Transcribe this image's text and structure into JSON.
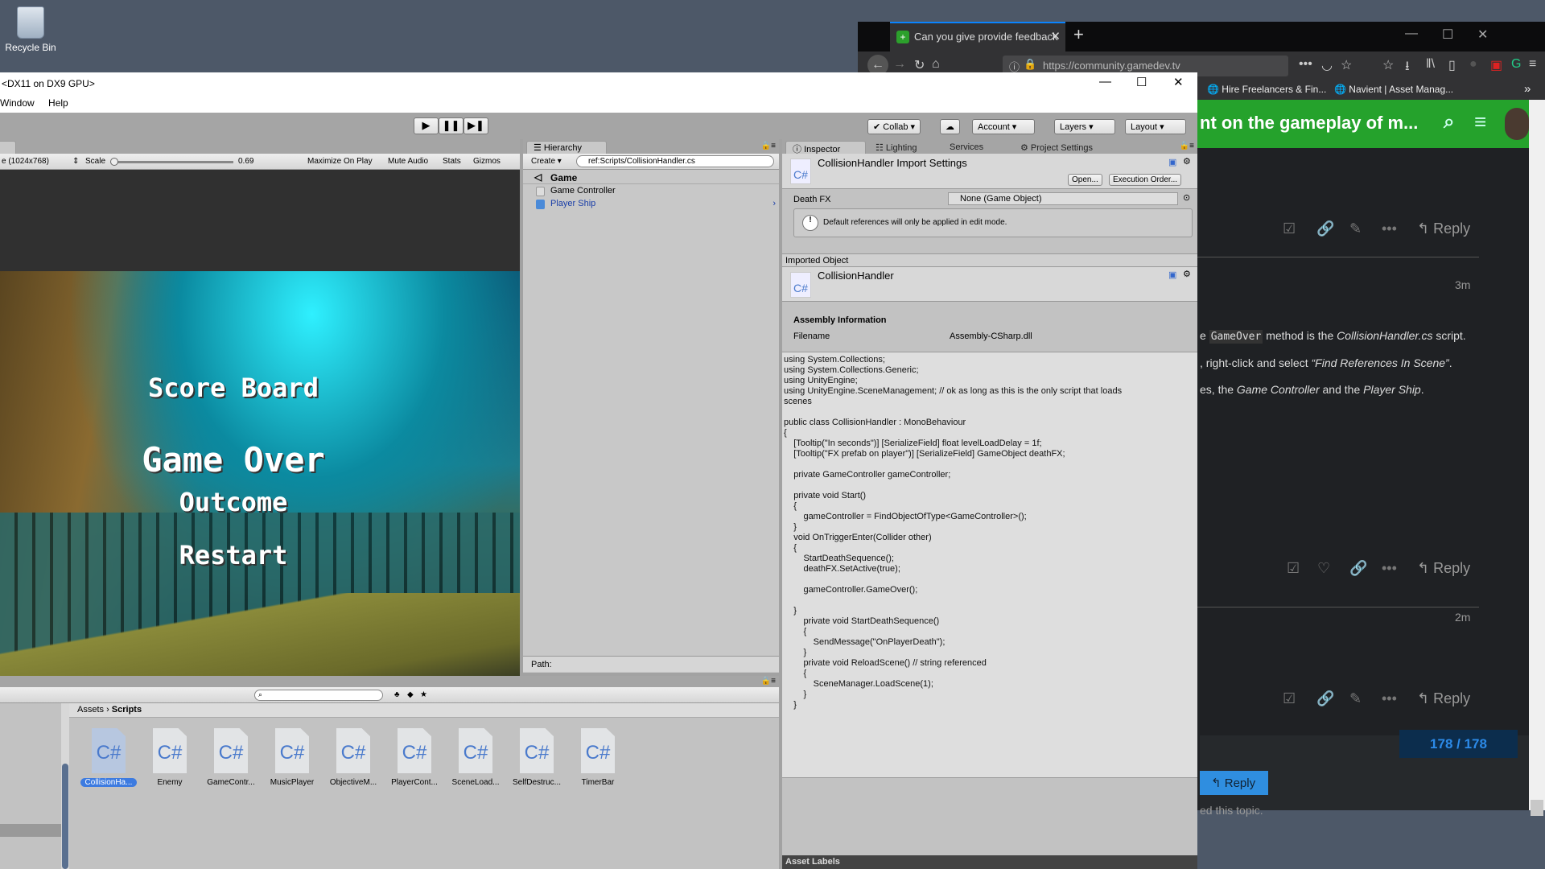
{
  "desktop": {
    "recycle_bin": "Recycle Bin"
  },
  "browser": {
    "tab_title": "Can you give provide feedback",
    "url": "https://community.gamedev.tv",
    "bookmarks": [
      "Hire Freelancers & Fin...",
      "Navient | Asset Manag..."
    ],
    "header_title": "nt on the gameplay of m...",
    "accent": "#25a22c",
    "posts": [
      {
        "reply": "Reply"
      },
      {
        "time": "3m",
        "lines": [
          {
            "pre": "e ",
            "code": "GameOver",
            "mid": " method is the ",
            "em": "CollisionHandler.cs",
            "post": " script."
          },
          {
            "pre": ", right-click and select ",
            "em": "“Find References In Scene”",
            "post": "."
          },
          {
            "pre": "es, the ",
            "em": "Game Controller",
            "mid": " and the ",
            "em2": "Player Ship",
            "post": "."
          }
        ],
        "reply": "Reply"
      },
      {
        "time": "2m",
        "reply": "Reply"
      }
    ],
    "progress": "178 / 178",
    "reply_button": "Reply",
    "footer_text": "ed this topic."
  },
  "unity": {
    "title": "<DX11 on DX9 GPU>",
    "menu": [
      "Window",
      "Help"
    ],
    "toolbar": {
      "collab": "Collab",
      "account": "Account",
      "layers": "Layers",
      "layout": "Layout"
    },
    "game": {
      "resolution": "e (1024x768)",
      "scale_label": "Scale",
      "scale_value": "0.69",
      "scale_fraction": 0.0,
      "buttons": [
        "Maximize On Play",
        "Mute Audio",
        "Stats",
        "Gizmos"
      ],
      "texts": {
        "score_board": "Score Board",
        "game_over": "Game Over",
        "outcome": "Outcome",
        "restart": "Restart"
      }
    },
    "hierarchy": {
      "tab": "Hierarchy",
      "create": "Create",
      "search": "ref:Scripts/CollisionHandler.cs",
      "scene": "Game",
      "items": [
        "Game Controller",
        "Player Ship"
      ],
      "path_label": "Path:"
    },
    "inspector": {
      "tabs": [
        "Inspector",
        "Lighting",
        "Services",
        "Project Settings"
      ],
      "header": "CollisionHandler Import Settings",
      "open": "Open...",
      "execution_order": "Execution Order...",
      "death_fx_label": "Death FX",
      "death_fx_value": "None (Game Object)",
      "warning": "Default references will only be applied in edit mode.",
      "imported_object": "Imported Object",
      "object_name": "CollisionHandler",
      "assembly_info": "Assembly Information",
      "filename_label": "Filename",
      "filename_value": "Assembly-CSharp.dll",
      "code": "using System.Collections;\nusing System.Collections.Generic;\nusing UnityEngine;\nusing UnityEngine.SceneManagement; // ok as long as this is the only script that loads\nscenes\n\npublic class CollisionHandler : MonoBehaviour\n{\n    [Tooltip(\"In seconds\")] [SerializeField] float levelLoadDelay = 1f;\n    [Tooltip(\"FX prefab on player\")] [SerializeField] GameObject deathFX;\n\n    private GameController gameController;\n\n    private void Start()\n    {\n        gameController = FindObjectOfType<GameController>();\n    }\n    void OnTriggerEnter(Collider other)\n    {\n        StartDeathSequence();\n        deathFX.SetActive(true);\n\n        gameController.GameOver();\n\n    }\n        private void StartDeathSequence()\n        {\n            SendMessage(\"OnPlayerDeath\");\n        }\n        private void ReloadScene() // string referenced\n        {\n            SceneManager.LoadScene(1);\n        }\n    }",
      "asset_labels": "Asset Labels"
    },
    "project": {
      "breadcrumb": [
        "Assets",
        "Scripts"
      ],
      "icon_text": "C#",
      "assets": [
        "CollisionHa...",
        "Enemy",
        "GameContr...",
        "MusicPlayer",
        "ObjectiveM...",
        "PlayerCont...",
        "SceneLoad...",
        "SelfDestruc...",
        "TimerBar"
      ],
      "selected": "CollisionHa..."
    }
  }
}
